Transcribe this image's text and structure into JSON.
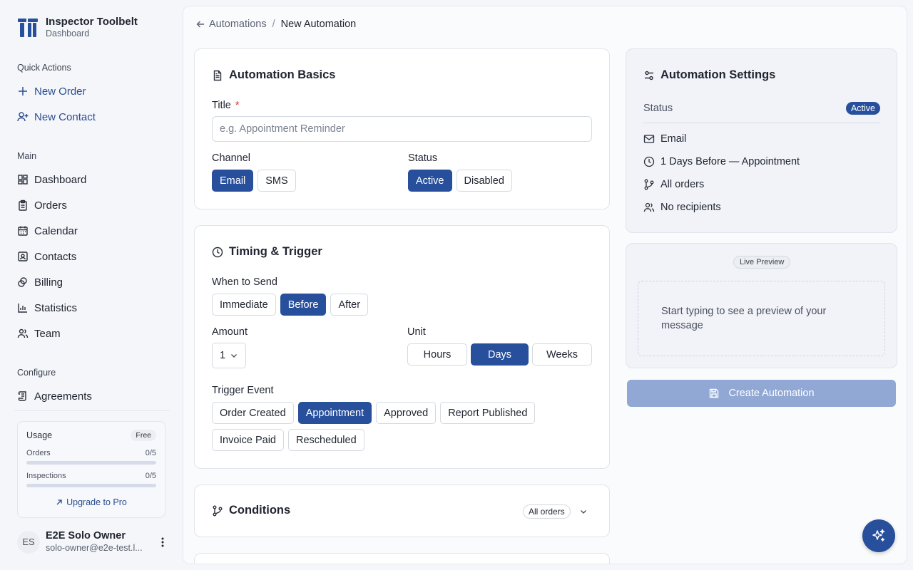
{
  "brand": {
    "title": "Inspector Toolbelt",
    "subtitle": "Dashboard"
  },
  "sidebar": {
    "quick_actions_label": "Quick Actions",
    "quick_actions": [
      {
        "label": "New Order",
        "icon": "plus-icon"
      },
      {
        "label": "New Contact",
        "icon": "user-plus-icon"
      }
    ],
    "main_label": "Main",
    "main_items": [
      {
        "label": "Dashboard",
        "icon": "dashboard-icon"
      },
      {
        "label": "Orders",
        "icon": "clipboard-icon"
      },
      {
        "label": "Calendar",
        "icon": "calendar-icon"
      },
      {
        "label": "Contacts",
        "icon": "contact-card-icon"
      },
      {
        "label": "Billing",
        "icon": "billing-icon"
      },
      {
        "label": "Statistics",
        "icon": "bar-chart-icon"
      },
      {
        "label": "Team",
        "icon": "team-icon"
      }
    ],
    "configure_label": "Configure",
    "configure_items": [
      {
        "label": "Agreements",
        "icon": "scroll-icon"
      }
    ],
    "usage": {
      "title": "Usage",
      "plan": "Free",
      "orders_label": "Orders",
      "orders_value": "0/5",
      "orders_fraction": 0,
      "inspections_label": "Inspections",
      "inspections_value": "0/5",
      "inspections_fraction": 0,
      "upgrade_label": "Upgrade to Pro"
    },
    "user": {
      "initials": "ES",
      "name": "E2E Solo Owner",
      "email": "solo-owner@e2e-test.l..."
    }
  },
  "breadcrumb": {
    "parent": "Automations",
    "separator": "/",
    "current": "New Automation"
  },
  "basics": {
    "title": "Automation Basics",
    "title_label": "Title",
    "required_mark": "*",
    "title_placeholder": "e.g. Appointment Reminder",
    "channel_label": "Channel",
    "channel_options": [
      "Email",
      "SMS"
    ],
    "status_label": "Status",
    "status_options": [
      "Active",
      "Disabled"
    ]
  },
  "timing": {
    "title": "Timing & Trigger",
    "when_label": "When to Send",
    "when_options": [
      "Immediate",
      "Before",
      "After"
    ],
    "amount_label": "Amount",
    "amount_value": "1",
    "unit_label": "Unit",
    "unit_options": [
      "Hours",
      "Days",
      "Weeks"
    ],
    "trigger_label": "Trigger Event",
    "trigger_options": [
      "Order Created",
      "Appointment",
      "Approved",
      "Report Published",
      "Invoice Paid",
      "Rescheduled"
    ]
  },
  "conditions": {
    "title": "Conditions",
    "badge": "All orders"
  },
  "settings": {
    "title": "Automation Settings",
    "status_label": "Status",
    "status_value": "Active",
    "channel": "Email",
    "timing": "1 Days Before — Appointment",
    "scope": "All orders",
    "recipients": "No recipients"
  },
  "preview": {
    "badge": "Live Preview",
    "placeholder": "Start typing to see a preview of your message"
  },
  "create_button": "Create Automation",
  "colors": {
    "primary": "#274f9c",
    "disabled_primary": "#91a8d4",
    "required": "#d63a3a"
  }
}
